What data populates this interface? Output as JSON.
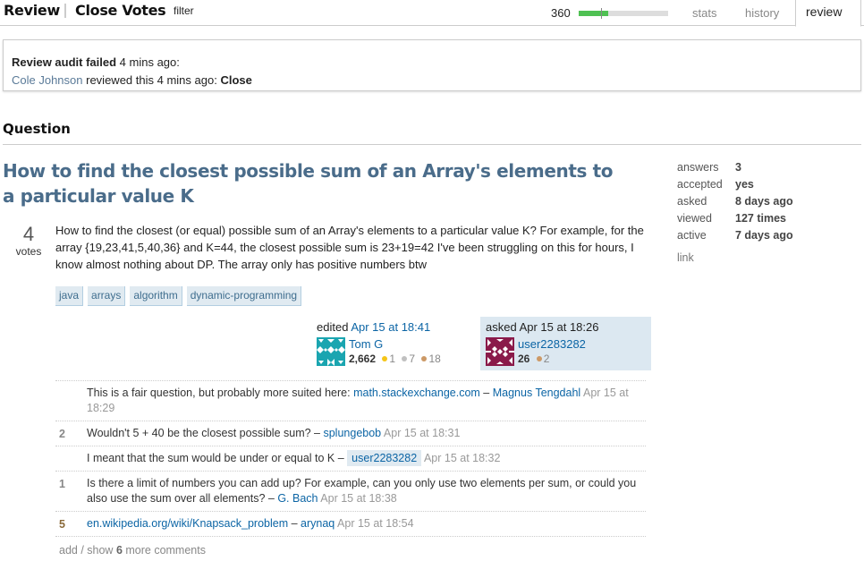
{
  "header": {
    "brand": "Review",
    "queue_name": "Close Votes",
    "filter_label": "filter",
    "review_count": "360",
    "progress_fraction": 0.33,
    "tabs": [
      {
        "label": "stats"
      },
      {
        "label": "history"
      },
      {
        "label": "review",
        "active": true
      }
    ]
  },
  "audit": {
    "title": "Review audit failed",
    "title_time": "4 mins ago:",
    "reviewer": "Cole Johnson",
    "reviewed_text": "reviewed this 4 mins ago:",
    "action": "Close"
  },
  "section_title": "Question",
  "question": {
    "title": "How to find the closest possible sum of an Array's elements to a particular value K",
    "votes": "4",
    "votes_label": "votes",
    "body": "How to find the closest (or equal) possible sum of an Array's elements to a particular value K? For example, for the array {19,23,41,5,40,36} and K=44, the closest possible sum is 23+19=42 I've been struggling on this for hours, I know almost nothing about DP. The array only has positive numbers btw",
    "tags": [
      "java",
      "arrays",
      "algorithm",
      "dynamic-programming"
    ],
    "edited": {
      "action": "edited",
      "time": "Apr 15 at 18:41",
      "user": "Tom G",
      "rep": "2,662",
      "gold": "1",
      "silver": "7",
      "bronze": "18",
      "avatar_color": "#1aa5b0"
    },
    "asked": {
      "action": "asked Apr 15 at 18:26",
      "user": "user2283282",
      "rep": "26",
      "bronze": "2",
      "avatar_color": "#8a1a4a"
    }
  },
  "comments": [
    {
      "score": "",
      "text": "This is a fair question, but probably more suited here:",
      "link": "math.stackexchange.com",
      "sep": " – ",
      "user": "Magnus Tengdahl",
      "date": " Apr 15 at 18:29"
    },
    {
      "score": "2",
      "text": "Wouldn't 5 + 40 be the closest possible sum?",
      "link": "",
      "sep": " – ",
      "user": "splungebob",
      "date": " Apr 15 at 18:31"
    },
    {
      "score": "",
      "text": "I meant that the sum would be under or equal to K",
      "link": "",
      "sep": " – ",
      "user": "user2283282",
      "date": " Apr 15 at 18:32",
      "owner": true
    },
    {
      "score": "1",
      "text": "Is there a limit of numbers you can add up? For example, can you only use two elements per sum, or could you also use the sum over all elements?",
      "link": "",
      "sep": " – ",
      "user": "G. Bach",
      "date": " Apr 15 at 18:38"
    },
    {
      "score": "5",
      "text": "",
      "link": "en.wikipedia.org/wiki/Knapsack_problem",
      "sep": " – ",
      "user": "arynaq",
      "date": " Apr 15 at 18:54",
      "hot": true
    }
  ],
  "more_comments": {
    "prefix": "add / show ",
    "count": "6",
    "suffix": " more comments"
  },
  "stats": [
    {
      "label": "answers",
      "value": "3"
    },
    {
      "label": "accepted",
      "value": "yes"
    },
    {
      "label": "asked",
      "value": "8 days ago"
    },
    {
      "label": "viewed",
      "value": "127 times"
    },
    {
      "label": "active",
      "value": "7 days ago"
    }
  ],
  "stats_link": "link"
}
